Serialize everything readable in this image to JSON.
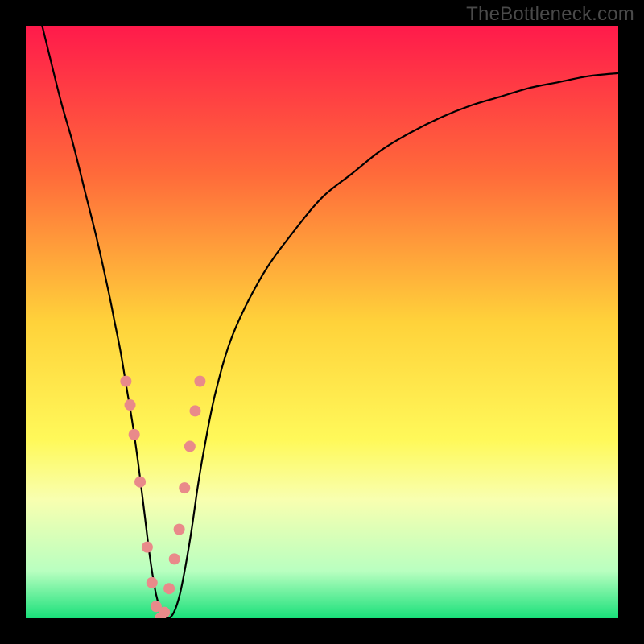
{
  "watermark": "TheBottleneck.com",
  "chart_data": {
    "type": "line",
    "title": "",
    "xlabel": "",
    "ylabel": "",
    "xlim": [
      0,
      100
    ],
    "ylim": [
      0,
      100
    ],
    "legend": false,
    "grid": false,
    "background_gradient": {
      "stops": [
        {
          "offset": 0.0,
          "color": "#ff1a4b"
        },
        {
          "offset": 0.25,
          "color": "#ff6a3a"
        },
        {
          "offset": 0.5,
          "color": "#ffd23a"
        },
        {
          "offset": 0.7,
          "color": "#fff95a"
        },
        {
          "offset": 0.8,
          "color": "#f8ffb0"
        },
        {
          "offset": 0.92,
          "color": "#b9ffc0"
        },
        {
          "offset": 1.0,
          "color": "#19e07a"
        }
      ]
    },
    "series": [
      {
        "name": "bottleneck-curve",
        "color": "#000000",
        "x": [
          0,
          2,
          4,
          6,
          8,
          10,
          12,
          14,
          15,
          16,
          17,
          18,
          19,
          20,
          21,
          22,
          23,
          24,
          25,
          26,
          27,
          28,
          29,
          30,
          32,
          35,
          40,
          45,
          50,
          55,
          60,
          65,
          70,
          75,
          80,
          85,
          90,
          95,
          100
        ],
        "y": [
          110,
          103,
          95,
          87,
          80,
          72,
          64,
          55,
          50,
          45,
          39,
          33,
          26,
          18,
          10,
          4,
          1,
          0,
          1,
          4,
          9,
          15,
          22,
          28,
          38,
          48,
          58,
          65,
          71,
          75,
          79,
          82,
          84.5,
          86.5,
          88,
          89.5,
          90.5,
          91.5,
          92
        ]
      }
    ],
    "markers": {
      "name": "highlighted-points",
      "color": "#e98a8a",
      "radius_px": 7,
      "x": [
        16.9,
        17.6,
        18.3,
        19.3,
        20.5,
        21.3,
        22.0,
        22.7,
        23.4,
        24.2,
        25.1,
        25.9,
        26.8,
        27.7,
        28.6,
        29.4
      ],
      "y": [
        40,
        36,
        31,
        23,
        12,
        6,
        2,
        0,
        1,
        5,
        10,
        15,
        22,
        29,
        35,
        40
      ]
    }
  }
}
